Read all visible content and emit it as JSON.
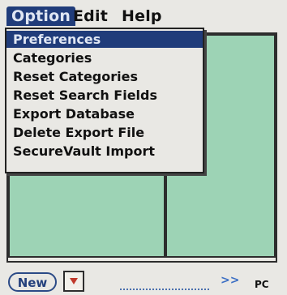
{
  "menubar": {
    "menus": [
      {
        "label": "Option"
      },
      {
        "label": "Edit"
      },
      {
        "label": "Help"
      }
    ]
  },
  "dropdown": {
    "items": [
      {
        "label": "Preferences"
      },
      {
        "label": "Categories"
      },
      {
        "label": "Reset Categories"
      },
      {
        "label": "Reset Search Fields"
      },
      {
        "label": "Export Database"
      },
      {
        "label": "Delete Export File"
      },
      {
        "label": "SecureVault Import"
      }
    ]
  },
  "bottom": {
    "new_label": "New",
    "chevrons": ">>",
    "pc_label": "PC"
  },
  "colors": {
    "panel_green": "#9dd3b5",
    "highlight_navy": "#203c7a",
    "background": "#e9e8e4"
  }
}
